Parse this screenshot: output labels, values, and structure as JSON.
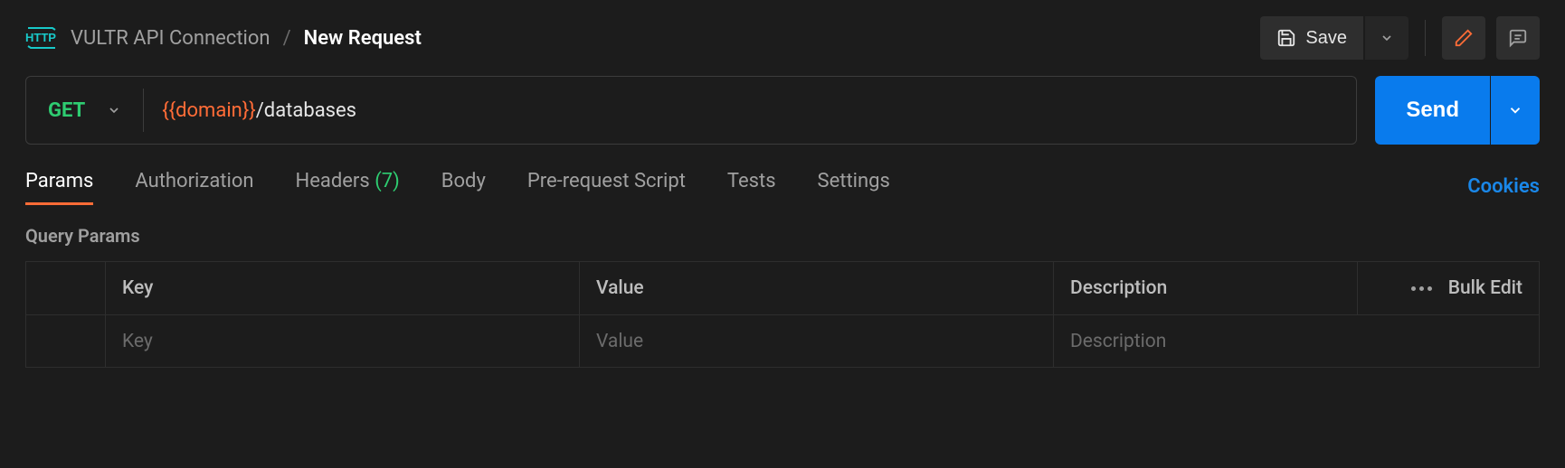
{
  "breadcrumb": {
    "collection": "VULTR API Connection",
    "current": "New Request"
  },
  "toolbar": {
    "save_label": "Save"
  },
  "request": {
    "method": "GET",
    "url_variable": "{{domain}}",
    "url_path": "/databases",
    "send_label": "Send"
  },
  "tabs": {
    "params": "Params",
    "authorization": "Authorization",
    "headers_label": "Headers",
    "headers_count": "(7)",
    "body": "Body",
    "prerequest": "Pre-request Script",
    "tests": "Tests",
    "settings": "Settings",
    "cookies": "Cookies"
  },
  "params_section": {
    "title": "Query Params",
    "col_key": "Key",
    "col_value": "Value",
    "col_desc": "Description",
    "bulk_edit": "Bulk Edit",
    "placeholder_key": "Key",
    "placeholder_value": "Value",
    "placeholder_desc": "Description"
  }
}
